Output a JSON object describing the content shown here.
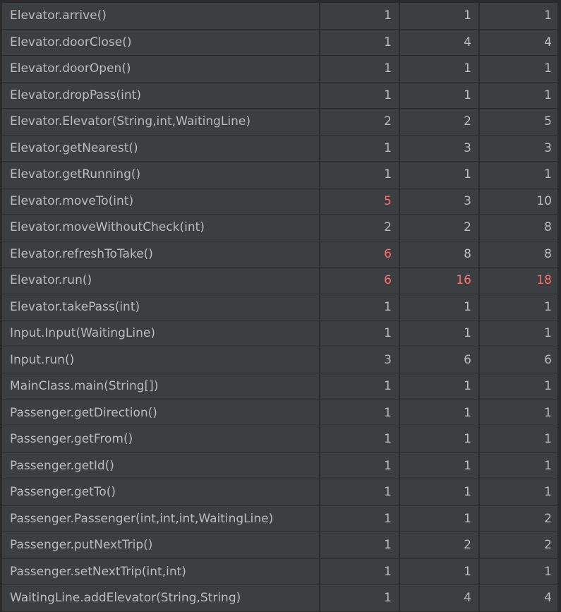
{
  "colors": {
    "background": "#2b2b2b",
    "cell": "#3c3f41",
    "text": "#bbbbbb",
    "highlight": "#ff6b68"
  },
  "rows": [
    {
      "method": "Elevator.arrive()",
      "v1": "1",
      "v2": "1",
      "v3": "1",
      "hot": []
    },
    {
      "method": "Elevator.doorClose()",
      "v1": "1",
      "v2": "4",
      "v3": "4",
      "hot": []
    },
    {
      "method": "Elevator.doorOpen()",
      "v1": "1",
      "v2": "1",
      "v3": "1",
      "hot": []
    },
    {
      "method": "Elevator.dropPass(int)",
      "v1": "1",
      "v2": "1",
      "v3": "1",
      "hot": []
    },
    {
      "method": "Elevator.Elevator(String,int,WaitingLine)",
      "v1": "2",
      "v2": "2",
      "v3": "5",
      "hot": []
    },
    {
      "method": "Elevator.getNearest()",
      "v1": "1",
      "v2": "3",
      "v3": "3",
      "hot": []
    },
    {
      "method": "Elevator.getRunning()",
      "v1": "1",
      "v2": "1",
      "v3": "1",
      "hot": []
    },
    {
      "method": "Elevator.moveTo(int)",
      "v1": "5",
      "v2": "3",
      "v3": "10",
      "hot": [
        "v1"
      ]
    },
    {
      "method": "Elevator.moveWithoutCheck(int)",
      "v1": "2",
      "v2": "2",
      "v3": "8",
      "hot": []
    },
    {
      "method": "Elevator.refreshToTake()",
      "v1": "6",
      "v2": "8",
      "v3": "8",
      "hot": [
        "v1"
      ]
    },
    {
      "method": "Elevator.run()",
      "v1": "6",
      "v2": "16",
      "v3": "18",
      "hot": [
        "v1",
        "v2",
        "v3"
      ]
    },
    {
      "method": "Elevator.takePass(int)",
      "v1": "1",
      "v2": "1",
      "v3": "1",
      "hot": []
    },
    {
      "method": "Input.Input(WaitingLine)",
      "v1": "1",
      "v2": "1",
      "v3": "1",
      "hot": []
    },
    {
      "method": "Input.run()",
      "v1": "3",
      "v2": "6",
      "v3": "6",
      "hot": []
    },
    {
      "method": "MainClass.main(String[])",
      "v1": "1",
      "v2": "1",
      "v3": "1",
      "hot": []
    },
    {
      "method": "Passenger.getDirection()",
      "v1": "1",
      "v2": "1",
      "v3": "1",
      "hot": []
    },
    {
      "method": "Passenger.getFrom()",
      "v1": "1",
      "v2": "1",
      "v3": "1",
      "hot": []
    },
    {
      "method": "Passenger.getId()",
      "v1": "1",
      "v2": "1",
      "v3": "1",
      "hot": []
    },
    {
      "method": "Passenger.getTo()",
      "v1": "1",
      "v2": "1",
      "v3": "1",
      "hot": []
    },
    {
      "method": "Passenger.Passenger(int,int,int,WaitingLine)",
      "v1": "1",
      "v2": "1",
      "v3": "2",
      "hot": []
    },
    {
      "method": "Passenger.putNextTrip()",
      "v1": "1",
      "v2": "2",
      "v3": "2",
      "hot": []
    },
    {
      "method": "Passenger.setNextTrip(int,int)",
      "v1": "1",
      "v2": "1",
      "v3": "1",
      "hot": []
    },
    {
      "method": "WaitingLine.addElevator(String,String)",
      "v1": "1",
      "v2": "4",
      "v3": "4",
      "hot": []
    }
  ]
}
